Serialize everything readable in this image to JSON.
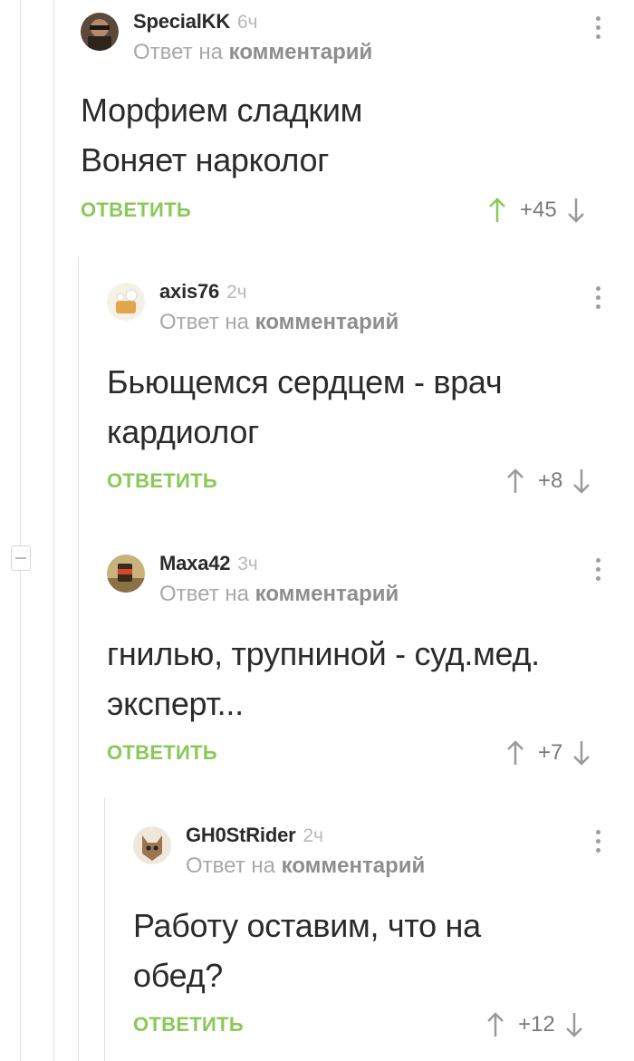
{
  "comments": [
    {
      "username": "SpecialKK",
      "time": "6ч",
      "reply_prefix": "Ответ на",
      "reply_link": "комментарий",
      "text": "Морфием сладким\nВоняет нарколог",
      "reply_label": "ОТВЕТИТЬ",
      "score": "+45",
      "upvoted": true
    },
    {
      "username": "axis76",
      "time": "2ч",
      "reply_prefix": "Ответ на",
      "reply_link": "комментарий",
      "text": "Бьющемся сердцем - врач\nкардиолог",
      "reply_label": "ОТВЕТИТЬ",
      "score": "+8",
      "upvoted": false
    },
    {
      "username": "Maxa42",
      "time": "3ч",
      "reply_prefix": "Ответ на",
      "reply_link": "комментарий",
      "text": "гнилью, трупниной - суд.мед.\nэксперт...",
      "reply_label": "ОТВЕТИТЬ",
      "score": "+7",
      "upvoted": false
    },
    {
      "username": "GH0StRider",
      "time": "2ч",
      "reply_prefix": "Ответ на",
      "reply_link": "комментарий",
      "text": "Работу оставим, что на\nобед?",
      "reply_label": "ОТВЕТИТЬ",
      "score": "+12",
      "upvoted": false
    }
  ],
  "colors": {
    "accent_green": "#8ac858",
    "text": "#2b2b2b",
    "muted": "#a8a8a8",
    "thread_line": "#e2e2e2"
  },
  "icons": {
    "more": "vertical-dots-icon",
    "upvote": "arrow-up-icon",
    "downvote": "arrow-down-icon",
    "collapse": "collapse-minus-icon"
  }
}
